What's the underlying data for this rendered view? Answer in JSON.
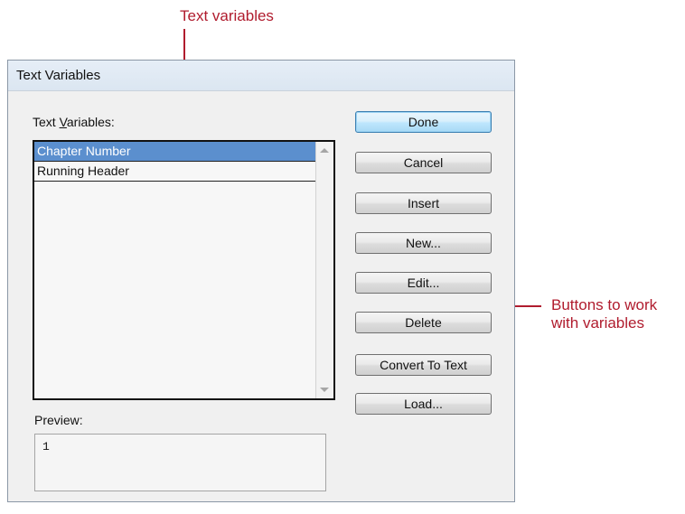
{
  "annotations": {
    "list_callout": "Text variables",
    "buttons_callout_line1": "Buttons to work",
    "buttons_callout_line2": "with variables"
  },
  "dialog": {
    "title": "Text Variables",
    "list_label_pre": "Text ",
    "list_label_accel": "V",
    "list_label_post": "ariables:",
    "items": [
      {
        "label": "Chapter Number",
        "selected": true
      },
      {
        "label": "Running Header",
        "selected": false
      }
    ],
    "preview_label": "Preview:",
    "preview_value": "1",
    "buttons": {
      "done": "Done",
      "cancel": "Cancel",
      "insert": "Insert",
      "new": "New...",
      "edit": "Edit...",
      "delete": "Delete",
      "convert": "Convert To Text",
      "load": "Load..."
    }
  },
  "colors": {
    "callout": "#b01c2e",
    "selection": "#5b8fce",
    "default_button_border": "#3c7fb1"
  }
}
